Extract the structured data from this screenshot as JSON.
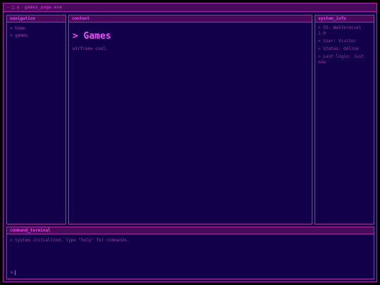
{
  "window": {
    "title": "games_page.exe",
    "buttons": [
      "-",
      "□",
      "x"
    ]
  },
  "navigation": {
    "header": "navigation",
    "items": [
      {
        "label": "> home"
      },
      {
        "label": "> games"
      }
    ]
  },
  "content": {
    "header": "content",
    "title": "> Games",
    "text": "wirframe cool."
  },
  "system_info": {
    "header": "system_info",
    "items": [
      {
        "label": "> OS: WebTerminal 1.0"
      },
      {
        "label": "> User: Visitor"
      },
      {
        "label": "> Status: Online"
      },
      {
        "label": "> Last login: Just now"
      }
    ]
  },
  "terminal": {
    "header": "command_terminal",
    "output": "> System initialized. Type \"help\" for commands.",
    "prompt": ">"
  },
  "colors": {
    "background": "#000000",
    "window": "#120040",
    "accent": "#e040ea",
    "border": "#a82bb0",
    "header_bg": "#4a0a5c"
  }
}
